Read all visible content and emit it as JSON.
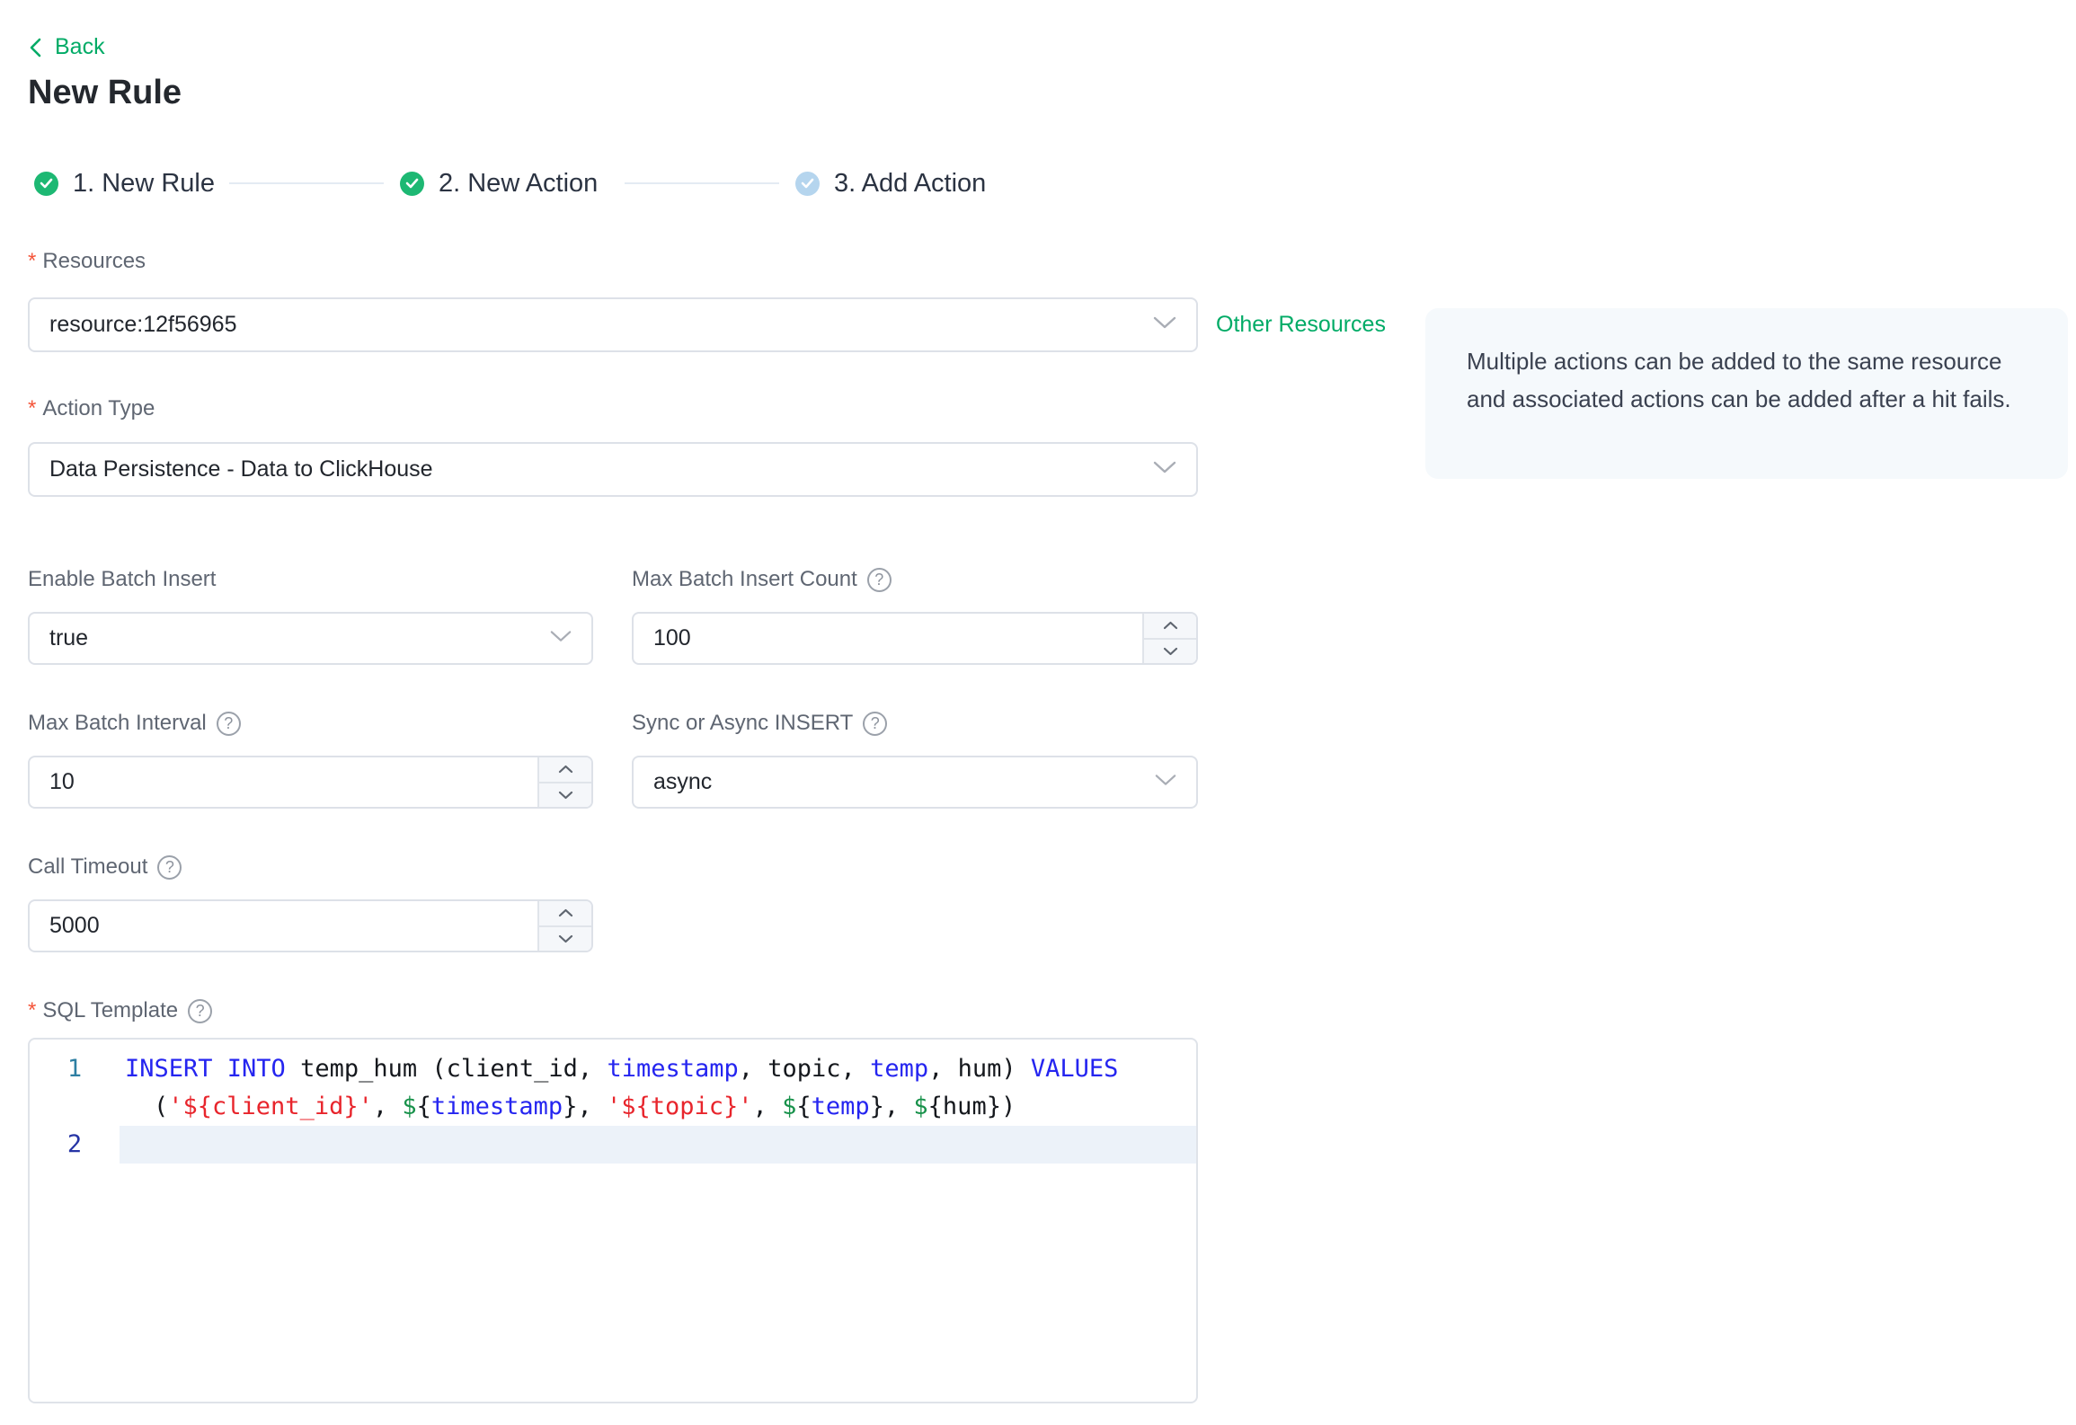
{
  "colors": {
    "accent_green": "#00ab66",
    "step_done_green": "#1db873",
    "step_pending_blue": "#b5d5ee",
    "info_box_bg": "#f5f9fc",
    "active_line_bg": "#ecf2f9",
    "code_keyword": "#2525f0",
    "code_string": "#e8252c",
    "code_dollar": "#17914a",
    "code_plain": "#15181d",
    "gutter_number": "#2e7fa3",
    "gutter_number_active": "#2634a5"
  },
  "header": {
    "back_label": "Back",
    "title": "New Rule"
  },
  "misc": {
    "required_mark": "*",
    "help_glyph": "?"
  },
  "steps": [
    {
      "label": "1. New Rule",
      "status": "done"
    },
    {
      "label": "2. New Action",
      "status": "done"
    },
    {
      "label": "3. Add Action",
      "status": "pending"
    }
  ],
  "form": {
    "resources": {
      "label": "Resources",
      "required": true,
      "value": "resource:12f56965",
      "side_link": "Other Resources"
    },
    "info_box": {
      "text": "Multiple actions can be added to the same resource and associated actions can be added after a hit fails."
    },
    "action_type": {
      "label": "Action Type",
      "required": true,
      "value": "Data Persistence - Data to ClickHouse"
    },
    "enable_batch": {
      "label": "Enable Batch Insert",
      "value": "true"
    },
    "max_batch_count": {
      "label": "Max Batch Insert Count",
      "has_help": true,
      "value": "100"
    },
    "max_batch_interval": {
      "label": "Max Batch Interval",
      "has_help": true,
      "value": "10"
    },
    "sync_async": {
      "label": "Sync or Async INSERT",
      "has_help": true,
      "value": "async"
    },
    "call_timeout": {
      "label": "Call Timeout",
      "has_help": true,
      "value": "5000"
    },
    "sql_template": {
      "label": "SQL Template",
      "required": true,
      "has_help": true
    }
  },
  "editor": {
    "lines": [
      {
        "number": "1",
        "active": false,
        "rows": [
          {
            "indent": 0,
            "segments": [
              {
                "t": "INSERT INTO",
                "c": "kw"
              },
              {
                "t": " temp_hum (client_id, ",
                "c": "pl"
              },
              {
                "t": "timestamp",
                "c": "kw"
              },
              {
                "t": ", topic, ",
                "c": "pl"
              },
              {
                "t": "temp",
                "c": "kw"
              },
              {
                "t": ", hum) ",
                "c": "pl"
              },
              {
                "t": "VALUES",
                "c": "kw"
              }
            ]
          },
          {
            "indent": 1,
            "segments": [
              {
                "t": "(",
                "c": "pl"
              },
              {
                "t": "'${client_id}'",
                "c": "str"
              },
              {
                "t": ", ",
                "c": "pl"
              },
              {
                "t": "$",
                "c": "dollar"
              },
              {
                "t": "{",
                "c": "pl"
              },
              {
                "t": "timestamp",
                "c": "kw"
              },
              {
                "t": "}, ",
                "c": "pl"
              },
              {
                "t": "'${topic}'",
                "c": "str"
              },
              {
                "t": ", ",
                "c": "pl"
              },
              {
                "t": "$",
                "c": "dollar"
              },
              {
                "t": "{",
                "c": "pl"
              },
              {
                "t": "temp",
                "c": "kw"
              },
              {
                "t": "}, ",
                "c": "pl"
              },
              {
                "t": "$",
                "c": "dollar"
              },
              {
                "t": "{hum})",
                "c": "pl"
              }
            ]
          }
        ]
      },
      {
        "number": "2",
        "active": true,
        "rows": [
          {
            "indent": 0,
            "segments": []
          }
        ]
      }
    ]
  }
}
